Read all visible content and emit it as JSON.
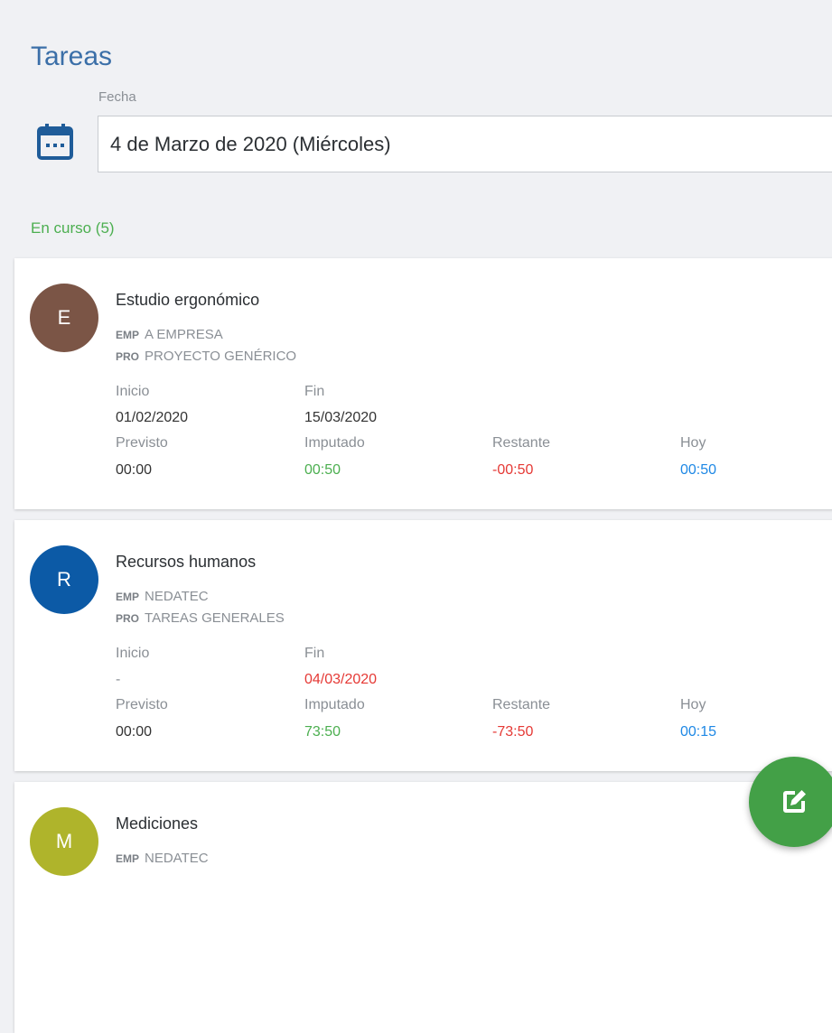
{
  "header": {
    "title": "Tareas"
  },
  "date": {
    "label": "Fecha",
    "value": "4 de Marzo de 2020 (Miércoles)"
  },
  "section": {
    "label": "En curso (5)"
  },
  "labels": {
    "emp": "EMP",
    "pro": "PRO",
    "inicio": "Inicio",
    "fin": "Fin",
    "previsto": "Previsto",
    "imputado": "Imputado",
    "restante": "Restante",
    "hoy": "Hoy"
  },
  "colors": {
    "accent": "#3b6fa8",
    "green": "#4caf50",
    "red": "#e53935",
    "blue": "#1e88e5",
    "fab": "#43a047"
  },
  "tasks": [
    {
      "initial": "E",
      "avatar_color": "#7b5546",
      "title": "Estudio ergonómico",
      "empresa": "A EMPRESA",
      "proyecto": "PROYECTO GENÉRICO",
      "inicio": "01/02/2020",
      "fin": "15/03/2020",
      "previsto": "00:00",
      "imputado": "00:50",
      "restante": "-00:50",
      "hoy": "00:50"
    },
    {
      "initial": "R",
      "avatar_color": "#0c5aa6",
      "title": "Recursos humanos",
      "empresa": "NEDATEC",
      "proyecto": "TAREAS GENERALES",
      "inicio": "-",
      "fin": "04/03/2020",
      "previsto": "00:00",
      "imputado": "73:50",
      "restante": "-73:50",
      "hoy": "00:15"
    },
    {
      "initial": "M",
      "avatar_color": "#afb42b",
      "title": "Mediciones",
      "empresa": "NEDATEC"
    }
  ],
  "fab": {
    "icon": "edit-icon"
  }
}
